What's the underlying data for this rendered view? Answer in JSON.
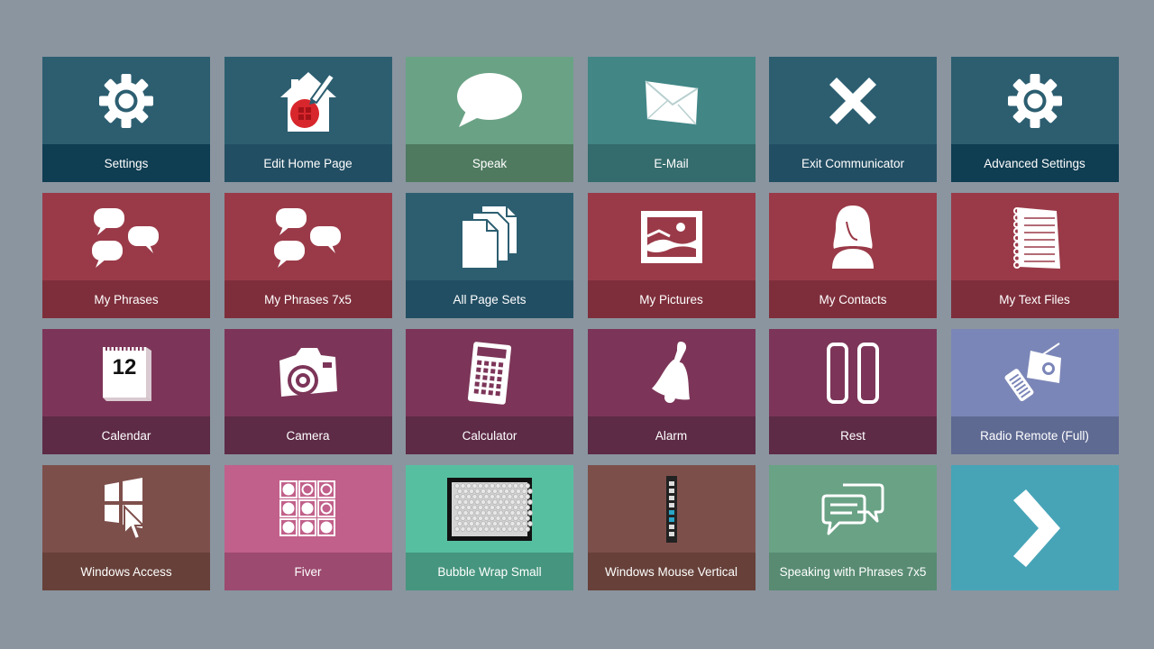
{
  "tiles": [
    {
      "label": "Settings",
      "icon": "gear-icon",
      "bg": "#2c5e70",
      "bar": "#0f3d52"
    },
    {
      "label": "Edit Home Page",
      "icon": "edit-home-icon",
      "bg": "#2c5e70",
      "bar": "#224e63"
    },
    {
      "label": "Speak",
      "icon": "speech-bubble-icon",
      "bg": "#6aa285",
      "bar": "#4f7a60"
    },
    {
      "label": "E-Mail",
      "icon": "envelope-icon",
      "bg": "#428686",
      "bar": "#346b6c"
    },
    {
      "label": "Exit Communicator",
      "icon": "close-icon",
      "bg": "#2c5e70",
      "bar": "#224e63"
    },
    {
      "label": "Advanced Settings",
      "icon": "gear-icon",
      "bg": "#2c5e70",
      "bar": "#0f3d52"
    },
    {
      "label": "My Phrases",
      "icon": "chat-bubbles-icon",
      "bg": "#9a3a48",
      "bar": "#7e2e3b"
    },
    {
      "label": "My Phrases 7x5",
      "icon": "chat-bubbles-icon",
      "bg": "#9a3a48",
      "bar": "#7e2e3b"
    },
    {
      "label": "All Page Sets",
      "icon": "documents-icon",
      "bg": "#2c5e70",
      "bar": "#224e63"
    },
    {
      "label": "My Pictures",
      "icon": "picture-icon",
      "bg": "#9a3a48",
      "bar": "#7e2e3b"
    },
    {
      "label": "My Contacts",
      "icon": "contact-person-icon",
      "bg": "#9a3a48",
      "bar": "#7e2e3b"
    },
    {
      "label": "My Text Files",
      "icon": "notepad-icon",
      "bg": "#9a3a48",
      "bar": "#7e2e3b"
    },
    {
      "label": "Calendar",
      "icon": "calendar-icon",
      "bg": "#7c3558",
      "bar": "#5d2b46",
      "calendar_day": "12"
    },
    {
      "label": "Camera",
      "icon": "camera-icon",
      "bg": "#7c3558",
      "bar": "#5d2b46"
    },
    {
      "label": "Calculator",
      "icon": "calculator-icon",
      "bg": "#7c3558",
      "bar": "#5d2b46"
    },
    {
      "label": "Alarm",
      "icon": "bell-icon",
      "bg": "#7c3558",
      "bar": "#5d2b46"
    },
    {
      "label": "Rest",
      "icon": "pause-icon",
      "bg": "#7c3558",
      "bar": "#5d2b46"
    },
    {
      "label": "Radio Remote (Full)",
      "icon": "radio-remote-icon",
      "bg": "#7b86b8",
      "bar": "#5f6a92"
    },
    {
      "label": "Windows Access",
      "icon": "windows-cursor-icon",
      "bg": "#7d4f4b",
      "bar": "#664039"
    },
    {
      "label": "Fiver",
      "icon": "grid-dots-icon",
      "bg": "#c1608a",
      "bar": "#9c4a6f"
    },
    {
      "label": "Bubble Wrap Small",
      "icon": "bubble-wrap-icon",
      "bg": "#56bf9f",
      "bar": "#46957e"
    },
    {
      "label": "Windows Mouse Vertical",
      "icon": "vertical-toolbar-icon",
      "bg": "#7d4f4b",
      "bar": "#664039"
    },
    {
      "label": "Speaking with Phrases 7x5",
      "icon": "chat-outline-icon",
      "bg": "#6aa285",
      "bar": "#588b72"
    },
    {
      "label": "",
      "icon": "chevron-right-icon",
      "bg": "#47a4b7",
      "bar": "#47a4b7"
    }
  ]
}
